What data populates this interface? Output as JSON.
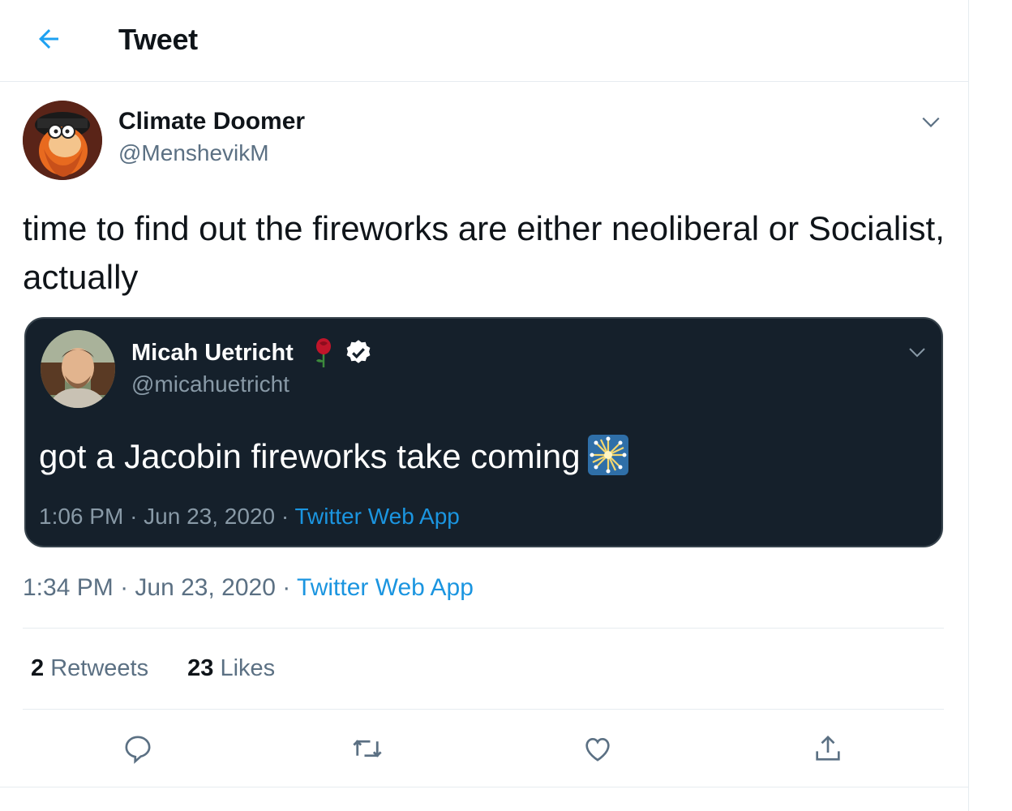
{
  "header": {
    "title": "Tweet",
    "back_icon": "arrow-left-icon"
  },
  "tweet": {
    "author_name": "Climate Doomer",
    "author_handle": "@MenshevikM",
    "text": "time to find out the fireworks are either neoliberal or Socialist, actually",
    "time": "1:34 PM",
    "date": "Jun 23, 2020",
    "source": "Twitter Web App",
    "separator": "·"
  },
  "quoted_tweet": {
    "author_name": "Micah Uetricht",
    "author_handle": "@micahuetricht",
    "text": "got a Jacobin fireworks take coming",
    "emoji": "sparkler-emoji",
    "time": "1:06 PM",
    "date": "Jun 23, 2020",
    "source": "Twitter Web App"
  },
  "stats": {
    "retweets_count": "2",
    "retweets_label": "Retweets",
    "likes_count": "23",
    "likes_label": "Likes"
  },
  "colors": {
    "accent": "#1b95e0",
    "quote_background": "#15202b",
    "secondary_text": "#5b7083"
  }
}
